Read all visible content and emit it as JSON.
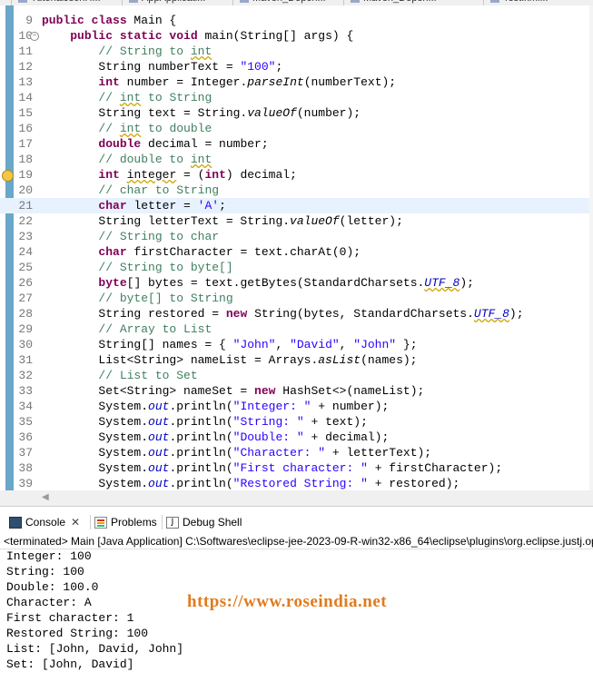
{
  "editor_tabs": [
    "TutorialJsonH...",
    "AppApplicati...",
    "Maven_Depen...",
    "Maven_Depen...",
    "Test.xml..."
  ],
  "code_lines": [
    {
      "n": "9",
      "parts": [
        [
          "kw",
          "public class "
        ],
        [
          "",
          "Main {"
        ]
      ]
    },
    {
      "n": "10",
      "parts": [
        [
          "",
          "    "
        ],
        [
          "kw",
          "public static void "
        ],
        [
          "",
          "main(String[] args) {"
        ]
      ],
      "fold": true
    },
    {
      "n": "11",
      "parts": [
        [
          "",
          "        "
        ],
        [
          "cm",
          "// String to "
        ],
        [
          "cm ul",
          "int"
        ]
      ]
    },
    {
      "n": "12",
      "parts": [
        [
          "",
          "        String numberText = "
        ],
        [
          "str",
          "\"100\""
        ],
        [
          "",
          ";"
        ]
      ]
    },
    {
      "n": "13",
      "parts": [
        [
          "",
          "        "
        ],
        [
          "kw",
          "int "
        ],
        [
          "",
          "number = Integer."
        ],
        [
          "ital",
          "parseInt"
        ],
        [
          "",
          "(numberText);"
        ]
      ]
    },
    {
      "n": "14",
      "parts": [
        [
          "",
          "        "
        ],
        [
          "cm",
          "// "
        ],
        [
          "cm ul",
          "int"
        ],
        [
          "cm",
          " to String"
        ]
      ]
    },
    {
      "n": "15",
      "parts": [
        [
          "",
          "        String text = String."
        ],
        [
          "ital",
          "valueOf"
        ],
        [
          "",
          "(number);"
        ]
      ]
    },
    {
      "n": "16",
      "parts": [
        [
          "",
          "        "
        ],
        [
          "cm",
          "// "
        ],
        [
          "cm ul",
          "int"
        ],
        [
          "cm",
          " to double"
        ]
      ]
    },
    {
      "n": "17",
      "parts": [
        [
          "",
          "        "
        ],
        [
          "kw",
          "double "
        ],
        [
          "",
          "decimal = number;"
        ]
      ]
    },
    {
      "n": "18",
      "parts": [
        [
          "",
          "        "
        ],
        [
          "cm",
          "// double to "
        ],
        [
          "cm ul",
          "int"
        ]
      ]
    },
    {
      "n": "19",
      "parts": [
        [
          "",
          "        "
        ],
        [
          "kw",
          "int "
        ],
        [
          "ul",
          "integer"
        ],
        [
          "",
          " = ("
        ],
        [
          "kw",
          "int"
        ],
        [
          "",
          ") decimal;"
        ]
      ],
      "warn": true
    },
    {
      "n": "20",
      "parts": [
        [
          "",
          "        "
        ],
        [
          "cm",
          "// char to String"
        ]
      ]
    },
    {
      "n": "21",
      "parts": [
        [
          "",
          "        "
        ],
        [
          "kw",
          "char "
        ],
        [
          "",
          "letter = "
        ],
        [
          "str",
          "'A'"
        ],
        [
          "",
          ";"
        ]
      ],
      "highlight": true
    },
    {
      "n": "22",
      "parts": [
        [
          "",
          "        String letterText = String."
        ],
        [
          "ital",
          "valueOf"
        ],
        [
          "",
          "(letter);"
        ]
      ]
    },
    {
      "n": "23",
      "parts": [
        [
          "",
          "        "
        ],
        [
          "cm",
          "// String to char"
        ]
      ]
    },
    {
      "n": "24",
      "parts": [
        [
          "",
          "        "
        ],
        [
          "kw",
          "char "
        ],
        [
          "",
          "firstCharacter = text.charAt(0);"
        ]
      ]
    },
    {
      "n": "25",
      "parts": [
        [
          "",
          "        "
        ],
        [
          "cm",
          "// String to byte[]"
        ]
      ]
    },
    {
      "n": "26",
      "parts": [
        [
          "",
          "        "
        ],
        [
          "kw",
          "byte"
        ],
        [
          "",
          "[] bytes = text.getBytes(StandardCharsets."
        ],
        [
          "fld ul",
          "UTF_8"
        ],
        [
          "",
          ");"
        ]
      ]
    },
    {
      "n": "27",
      "parts": [
        [
          "",
          "        "
        ],
        [
          "cm",
          "// byte[] to String"
        ]
      ]
    },
    {
      "n": "28",
      "parts": [
        [
          "",
          "        String restored = "
        ],
        [
          "kw",
          "new "
        ],
        [
          "",
          "String(bytes, StandardCharsets."
        ],
        [
          "fld ul",
          "UTF_8"
        ],
        [
          "",
          ");"
        ]
      ]
    },
    {
      "n": "29",
      "parts": [
        [
          "",
          "        "
        ],
        [
          "cm",
          "// Array to List"
        ]
      ]
    },
    {
      "n": "30",
      "parts": [
        [
          "",
          "        String[] names = { "
        ],
        [
          "str",
          "\"John\""
        ],
        [
          "",
          ", "
        ],
        [
          "str",
          "\"David\""
        ],
        [
          "",
          ", "
        ],
        [
          "str",
          "\"John\""
        ],
        [
          "",
          " };"
        ]
      ]
    },
    {
      "n": "31",
      "parts": [
        [
          "",
          "        List<String> nameList = Arrays."
        ],
        [
          "ital",
          "asList"
        ],
        [
          "",
          "(names);"
        ]
      ]
    },
    {
      "n": "32",
      "parts": [
        [
          "",
          "        "
        ],
        [
          "cm",
          "// List to Set"
        ]
      ]
    },
    {
      "n": "33",
      "parts": [
        [
          "",
          "        Set<String> nameSet = "
        ],
        [
          "kw",
          "new "
        ],
        [
          "",
          "HashSet<>(nameList);"
        ]
      ]
    },
    {
      "n": "34",
      "parts": [
        [
          "",
          "        System."
        ],
        [
          "fld",
          "out"
        ],
        [
          "",
          ".println("
        ],
        [
          "str",
          "\"Integer: \""
        ],
        [
          "",
          " + number);"
        ]
      ]
    },
    {
      "n": "35",
      "parts": [
        [
          "",
          "        System."
        ],
        [
          "fld",
          "out"
        ],
        [
          "",
          ".println("
        ],
        [
          "str",
          "\"String: \""
        ],
        [
          "",
          " + text);"
        ]
      ]
    },
    {
      "n": "36",
      "parts": [
        [
          "",
          "        System."
        ],
        [
          "fld",
          "out"
        ],
        [
          "",
          ".println("
        ],
        [
          "str",
          "\"Double: \""
        ],
        [
          "",
          " + decimal);"
        ]
      ]
    },
    {
      "n": "37",
      "parts": [
        [
          "",
          "        System."
        ],
        [
          "fld",
          "out"
        ],
        [
          "",
          ".println("
        ],
        [
          "str",
          "\"Character: \""
        ],
        [
          "",
          " + letterText);"
        ]
      ]
    },
    {
      "n": "38",
      "parts": [
        [
          "",
          "        System."
        ],
        [
          "fld",
          "out"
        ],
        [
          "",
          ".println("
        ],
        [
          "str",
          "\"First character: \""
        ],
        [
          "",
          " + firstCharacter);"
        ]
      ]
    },
    {
      "n": "39",
      "parts": [
        [
          "",
          "        System."
        ],
        [
          "fld",
          "out"
        ],
        [
          "",
          ".println("
        ],
        [
          "str",
          "\"Restored String: \""
        ],
        [
          "",
          " + restored);"
        ]
      ]
    }
  ],
  "views": {
    "console_label": "Console",
    "problems_label": "Problems",
    "debug_shell_label": "Debug Shell",
    "close_glyph": "✕"
  },
  "launch_info": "<terminated> Main [Java Application] C:\\Softwares\\eclipse-jee-2023-09-R-win32-x86_64\\eclipse\\plugins\\org.eclipse.justj.openjdk.hot",
  "console_output": [
    "Integer: 100",
    "String: 100",
    "Double: 100.0",
    "Character: A",
    "First character: 1",
    "Restored String: 100",
    "List: [John, David, John]",
    "Set: [John, David]"
  ],
  "watermark": "https://www.roseindia.net",
  "colors": {
    "keyword": "#7f0055",
    "string": "#2a00ff",
    "comment": "#3f7f5f",
    "field": "#0000c0",
    "watermark": "#e07b1f",
    "change_bar": "#6aa7c9"
  }
}
